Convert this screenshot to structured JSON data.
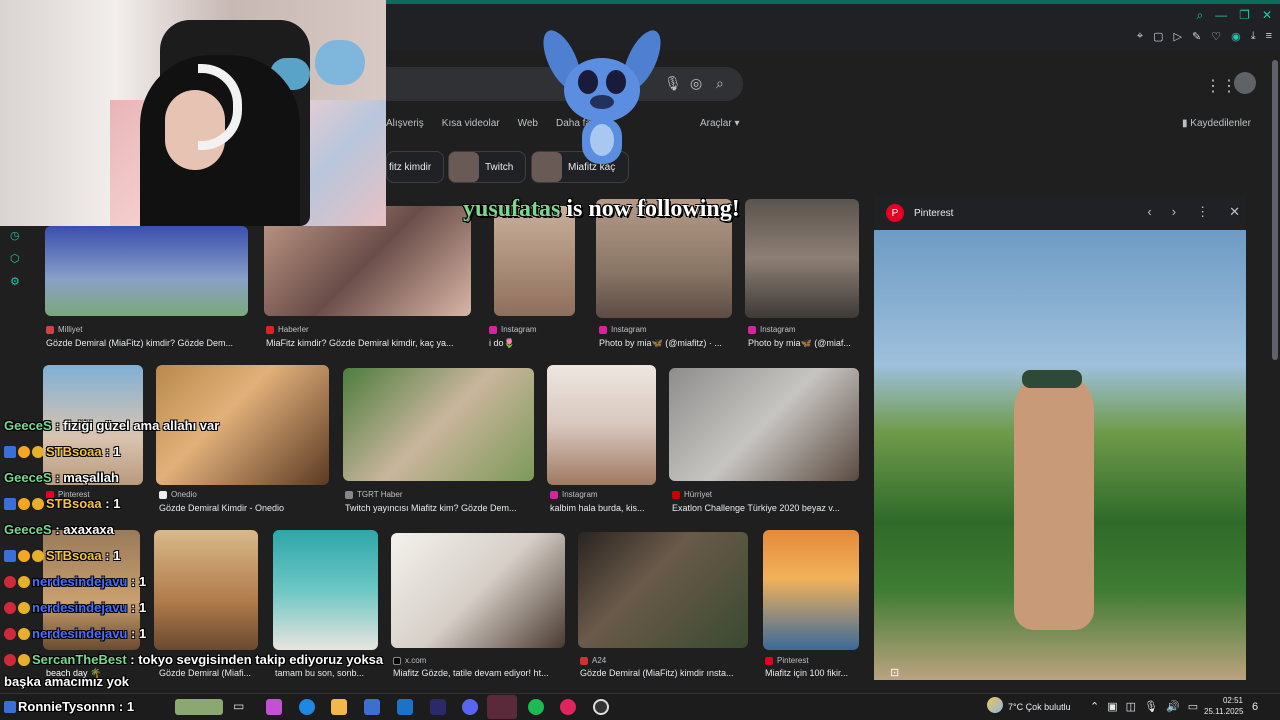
{
  "toolbar": {
    "window_controls": [
      "search-icon",
      "minimize-icon",
      "restore-icon",
      "close-icon"
    ],
    "extension_icons": [
      "pin-icon",
      "tab-icon",
      "play-icon",
      "edit-icon",
      "heart-icon",
      "account-icon",
      "download-icon",
      "menu-icon"
    ]
  },
  "search": {
    "icons": [
      "mic-icon",
      "lens-icon",
      "search-icon"
    ]
  },
  "tabs": [
    "Alışveriş",
    "Kısa videolar",
    "Web",
    "Daha fa..."
  ],
  "tools_label": "Araçlar",
  "saved_label": "Kaydedilenler",
  "chips": [
    {
      "label": "fitz kimdir"
    },
    {
      "label": "Twitch"
    },
    {
      "label": "Miafitz kaç"
    }
  ],
  "follow_alert": {
    "user": "yusufatas",
    "text": " is now following!"
  },
  "results": {
    "row1": [
      {
        "source": "Milliyet",
        "title": "Gözde Demiral (MiaFitz) kimdir? Gözde Dem..."
      },
      {
        "source": "Haberler",
        "title": "MiaFitz kimdir? Gözde Demiral kimdir, kaç ya..."
      },
      {
        "source": "Instagram",
        "title": "i do🌷"
      },
      {
        "source": "Instagram",
        "title": "Photo by mia🦋 (@miafitz) · ..."
      },
      {
        "source": "Instagram",
        "title": "Photo by mia🦋 (@miaf..."
      }
    ],
    "row2": [
      {
        "source": "Pinterest",
        "title": ""
      },
      {
        "source": "Onedio",
        "title": "Gözde Demiral Kimdir - Onedio"
      },
      {
        "source": "TGRT Haber",
        "title": "Twitch yayıncısı Miafitz kim? Gözde Dem..."
      },
      {
        "source": "Instagram",
        "title": "kalbim hala burda, kis..."
      },
      {
        "source": "Hürriyet",
        "title": "Exatlon Challenge Türkiye 2020 beyaz v..."
      }
    ],
    "row3": [
      {
        "source": "",
        "title": "Gözde Demiral (Miafi..."
      },
      {
        "source": "",
        "title": "tamam bu son, sonb..."
      },
      {
        "source": "x.com",
        "title": "Miafitz Gözde, tatile devam ediyor! ht..."
      },
      {
        "source": "A24",
        "title": "Gözde Demiral (MiaFitz) kimdir ınsta..."
      },
      {
        "source": "Pinterest",
        "title": "Miafitz için 100 fikir..."
      }
    ]
  },
  "panel": {
    "title": "Pinterest"
  },
  "chat": [
    {
      "user": "GeeceS",
      "msg": ": fiziği güzel ama allahı var",
      "color": "#7bd88f"
    },
    {
      "user": "STBsoaa",
      "msg": ": 1",
      "color": "#f5c542"
    },
    {
      "user": "GeeceS",
      "msg": ": maşallah",
      "color": "#7bd88f"
    },
    {
      "user": "STBsoaa",
      "msg": ": 1",
      "color": "#f5c542"
    },
    {
      "user": "GeeceS",
      "msg": ": axaxaxa",
      "color": "#7bd88f"
    },
    {
      "user": "STBsoaa",
      "msg": ": 1",
      "color": "#f5c542"
    },
    {
      "user": "nerdesindejavu",
      "msg": ": 1",
      "color": "#4a6fff"
    },
    {
      "user": "nerdesindejavu",
      "msg": ": 1",
      "color": "#4a6fff"
    },
    {
      "user": "nerdesindejavu",
      "msg": ": 1",
      "color": "#4a6fff"
    },
    {
      "user": "SercanTheBest",
      "msg": ": tokyo sevgisinden takip ediyoruz yoksa",
      "color": "#7bd88f"
    },
    {
      "user": "",
      "msg": "başka amacımız yok",
      "color": "#ffffff"
    },
    {
      "user": "RonnieTysonnn",
      "msg": ": 1",
      "color": "#ffffff"
    }
  ],
  "row3_extra": "beach day 🌴",
  "taskbar": {
    "weather": "7°C  Çok bulutlu",
    "time": "02:51",
    "date": "25.11.2025",
    "notif": "6"
  },
  "colors": {
    "accent": "#24c6a8",
    "follow_user": "#7bd88f",
    "pinterest": "#e60023"
  }
}
